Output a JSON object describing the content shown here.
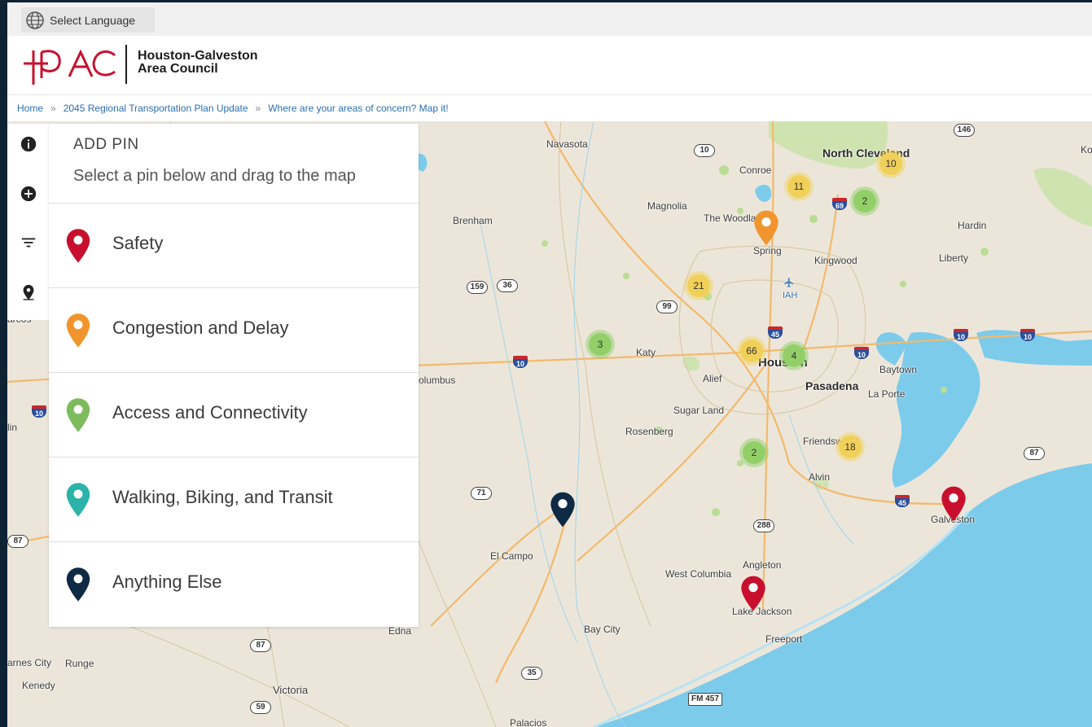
{
  "language_bar": {
    "label": "Select Language"
  },
  "header": {
    "org_line1": "Houston-Galveston",
    "org_line2": "Area Council",
    "logo_text": "H-GAC",
    "colors": {
      "logo": "#c8102e"
    }
  },
  "breadcrumb": {
    "items": [
      "Home",
      "2045 Regional Transportation Plan Update",
      "Where are your areas of concern? Map it!"
    ],
    "separator": "»"
  },
  "rail": {
    "icons": [
      "info-icon",
      "add-circle-icon",
      "filter-icon",
      "location-pin-icon"
    ]
  },
  "panel": {
    "title": "ADD PIN",
    "subtitle": "Select a pin below and drag to the map",
    "pins": [
      {
        "label": "Safety",
        "color": "#c8102e"
      },
      {
        "label": "Congestion and Delay",
        "color": "#f0952e"
      },
      {
        "label": "Access and Connectivity",
        "color": "#7dbb5d"
      },
      {
        "label": "Walking, Biking, and Transit",
        "color": "#2bb3aa"
      },
      {
        "label": "Anything Else",
        "color": "#0f2a44"
      }
    ]
  },
  "map": {
    "places": {
      "navasota": "Navasota",
      "conroe": "Conroe",
      "north_cleveland": "North Cleveland",
      "magnolia": "Magnolia",
      "the_woodlands": "The Woodlands",
      "brenham": "Brenham",
      "hardin": "Hardin",
      "spring": "Spring",
      "kingwood": "Kingwood",
      "liberty": "Liberty",
      "iah": "IAH",
      "katy": "Katy",
      "houston": "Houston",
      "pasadena": "Pasadena",
      "baytown": "Baytown",
      "alief": "Alief",
      "columbus": "olumbus",
      "la_porte": "La Porte",
      "sugar_land": "Sugar Land",
      "rosenberg": "Rosenberg",
      "friendswood": "Friendswood",
      "alvin": "Alvin",
      "galveston": "Galveston",
      "el_campo": "El Campo",
      "angleton": "Angleton",
      "west_columbia": "West Columbia",
      "lake_jackson": "Lake Jackson",
      "edna": "Edna",
      "bay_city": "Bay City",
      "freeport": "Freeport",
      "karnes_city": "arnes City",
      "runge": "Runge",
      "kenedy": "Kenedy",
      "victoria": "Victoria",
      "palacios": "Palacios",
      "marcos": "arcos",
      "lin": "lin",
      "ko": "Ko"
    },
    "route_shields": [
      "146",
      "10",
      "159",
      "36",
      "99",
      "71",
      "288",
      "87",
      "35",
      "59",
      "87",
      "FM 457",
      "87",
      "59",
      "87"
    ],
    "interstate_shields": [
      "69",
      "45",
      "10",
      "10",
      "10",
      "10",
      "10",
      "45"
    ],
    "clusters": [
      {
        "count": "11",
        "level": "yellow"
      },
      {
        "count": "10",
        "level": "yellow"
      },
      {
        "count": "2",
        "level": "green"
      },
      {
        "count": "21",
        "level": "yellow"
      },
      {
        "count": "3",
        "level": "green"
      },
      {
        "count": "66",
        "level": "yellow"
      },
      {
        "count": "4",
        "level": "green"
      },
      {
        "count": "18",
        "level": "yellow"
      },
      {
        "count": "2",
        "level": "green"
      }
    ],
    "pins": [
      {
        "category": "Congestion and Delay",
        "color": "#f0952e"
      },
      {
        "category": "Safety",
        "color": "#c8102e"
      },
      {
        "category": "Safety",
        "color": "#c8102e"
      },
      {
        "category": "Anything Else",
        "color": "#0f2a44"
      }
    ],
    "colors": {
      "water": "#7ccbeb",
      "land": "#ece6da",
      "park": "#cfe3b1",
      "road": "#f3b96b"
    }
  }
}
